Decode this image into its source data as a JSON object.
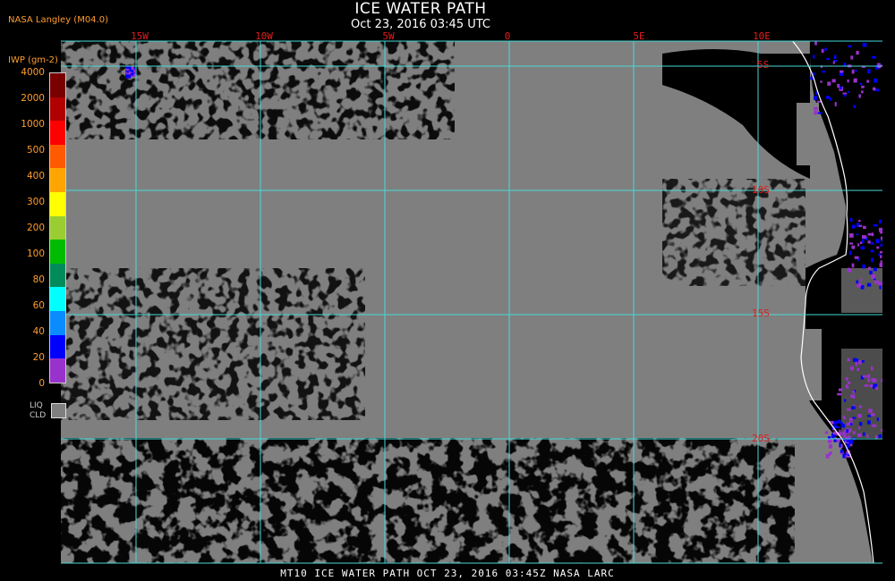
{
  "header": {
    "title": "ICE WATER PATH",
    "subtitle": "Oct 23, 2016 03:45 UTC",
    "credit": "NASA Langley (M04.0)"
  },
  "legend": {
    "label": "IWP (gm-2)",
    "values": [
      "4000",
      "2000",
      "1000",
      "500",
      "400",
      "300",
      "200",
      "100",
      "80",
      "60",
      "40",
      "20",
      "0"
    ],
    "colors": [
      "#7a0000",
      "#b00000",
      "#ff0000",
      "#ff5a00",
      "#ffa500",
      "#ffff00",
      "#9acd32",
      "#00bb00",
      "#008b5a",
      "#00ffff",
      "#0a8cff",
      "#0000ff",
      "#9932cc"
    ],
    "liq_label_1": "LIQ",
    "liq_label_2": "CLD",
    "liq_color": "#7f7f7f"
  },
  "map": {
    "lon_labels": [
      "15W",
      "10W",
      "5W",
      "0",
      "5E",
      "10E"
    ],
    "lat_labels": [
      "5S",
      "10S",
      "15S",
      "20S"
    ],
    "grid_color": "#48d8d8",
    "cloud_color": "#7f7f7f",
    "clear_color": "#000000",
    "coast_color": "#ffffff"
  },
  "footer": {
    "text": "MT10  ICE WATER PATH  OCT 23, 2016 03:45Z  NASA LARC"
  }
}
